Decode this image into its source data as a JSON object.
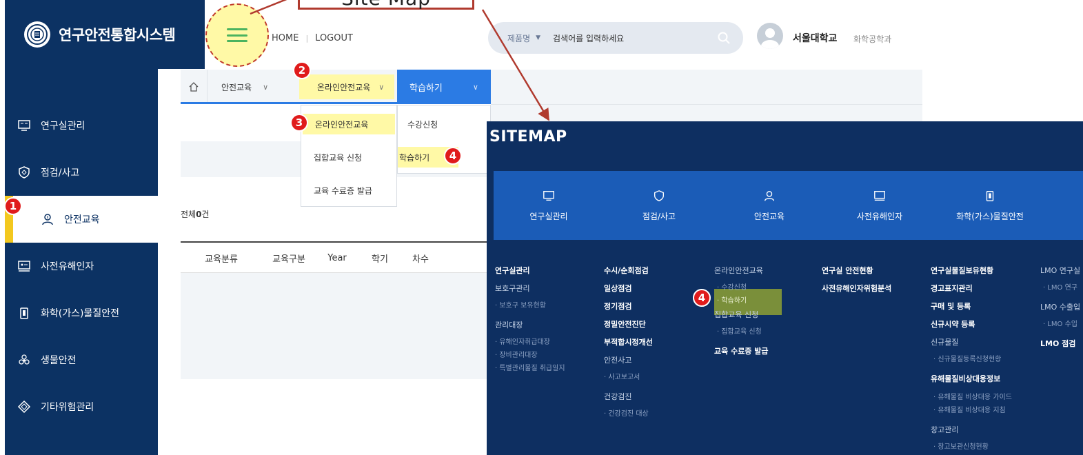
{
  "callout": {
    "text": "Site Map"
  },
  "header": {
    "brand": "연구안전통합시스템",
    "links": [
      "HOME",
      "LOGOUT"
    ],
    "search": {
      "select": "제품명",
      "placeholder": "검색어를 입력하세요"
    },
    "user": {
      "name": "서울대학교",
      "dept": "화학공학과"
    }
  },
  "sidebar": {
    "items": [
      {
        "label": "연구실관리",
        "icon": "monitor-icon"
      },
      {
        "label": "점검/사고",
        "icon": "shield-icon"
      },
      {
        "label": "안전교육",
        "icon": "education-icon",
        "active": true
      },
      {
        "label": "사전유해인자",
        "icon": "screen-icon"
      },
      {
        "label": "화학(가스)물질안전",
        "icon": "chemical-icon"
      },
      {
        "label": "생물안전",
        "icon": "biohazard-icon"
      },
      {
        "label": "기타위험관리",
        "icon": "diamond-icon"
      }
    ]
  },
  "breadcrumb": {
    "level1": "안전교육",
    "level2": "온라인안전교육",
    "level3": "학습하기",
    "menu1": [
      "온라인안전교육",
      "집합교육 신청",
      "교육 수료증 발급"
    ],
    "menu2": [
      "수강신청",
      "학습하기"
    ]
  },
  "content": {
    "total_prefix": "전체",
    "total_count": "0",
    "total_suffix": "건",
    "columns": [
      "교육분류",
      "교육구분",
      "Year",
      "학기",
      "차수"
    ]
  },
  "badges": {
    "b1": "1",
    "b2": "2",
    "b3": "3",
    "b4": "4",
    "b5": "4"
  },
  "sitemap": {
    "title": "SITEMAP",
    "categories": [
      "연구실관리",
      "점검/사고",
      "안전교육",
      "사전유해인자",
      "화학(가스)물질안전"
    ],
    "columns": [
      {
        "h1": "연구실관리",
        "t1": "보호구관리",
        "s1": "· 보호구 보유현황",
        "t2": "관리대장",
        "s2": "· 유해인자취급대장",
        "s3": "· 장비관리대장",
        "s4": "· 특별관리물질 취급일지"
      },
      {
        "h1": "수시/순회점검",
        "h2": "일상점검",
        "h3": "정기점검",
        "h4": "정밀안전진단",
        "h5": "부적합시정개선",
        "t1": "안전사고",
        "s1": "· 사고보고서",
        "t2": "건강검진",
        "s2": "· 건강검진 대상"
      },
      {
        "t1": "온라인안전교육",
        "s1": "· 수강신청",
        "s2": "· 학습하기",
        "t2": "집합교육 신청",
        "s3": "· 집합교육 신청",
        "h1": "교육 수료증 발급"
      },
      {
        "h1": "연구실 안전현황",
        "h2": "사전유해인자위험분석"
      },
      {
        "h1": "연구실물질보유현황",
        "h2": "경고표지관리",
        "h3": "구매 및 등록",
        "h4": "신규시약 등록",
        "t1": "신규물질",
        "s1": "· 신규물질등록신청현황",
        "h5": "유해물질비상대응정보",
        "s2": "· 유해물질 비상대응 가이드",
        "s3": "· 유해물질 비상대응 지침",
        "h6": "창고관리",
        "s4": "· 창고보관신청현황"
      },
      {
        "t1": "LMO 연구실",
        "s1": "· LMO 연구",
        "t2": "LMO 수출입",
        "s2": "· LMO 수입",
        "h1": "LMO 점검"
      }
    ]
  }
}
